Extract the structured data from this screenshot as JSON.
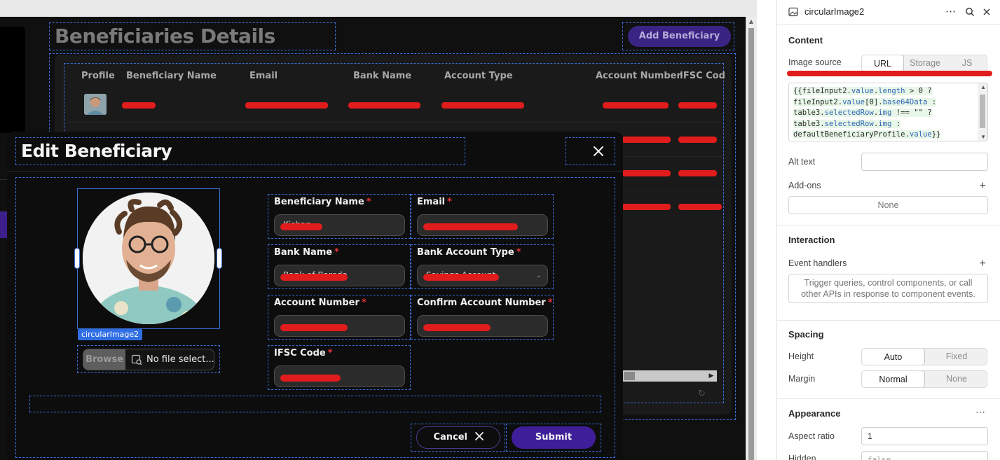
{
  "canvas": {
    "page_title": "Beneficiaries Details",
    "add_button": "Add Beneficiary",
    "table": {
      "columns": [
        "Profile",
        "Beneficiary Name",
        "Email",
        "Bank Name",
        "Account Type",
        "Account Number",
        "IFSC Cod"
      ]
    }
  },
  "modal": {
    "title": "Edit Beneficiary",
    "component_tag": "circularImage2",
    "file_input": {
      "browse_label": "Browse",
      "placeholder": "No file select..."
    },
    "fields": [
      {
        "label": "Beneficiary Name",
        "required": "*",
        "value": "Kishan"
      },
      {
        "label": "Email",
        "required": "*",
        "value": ""
      },
      {
        "label": "Bank Name",
        "required": "*",
        "value": "Bank of Baroda"
      },
      {
        "label": "Bank Account Type",
        "required": "*",
        "value": "Savings Account"
      },
      {
        "label": "Account Number",
        "required": "*",
        "value": ""
      },
      {
        "label": "Confirm Account Number",
        "required": "*",
        "value": ""
      },
      {
        "label": "IFSC Code",
        "required": "*",
        "value": ""
      }
    ],
    "cancel_label": "Cancel",
    "submit_label": "Submit"
  },
  "inspector": {
    "component_name": "circularImage2",
    "content_heading": "Content",
    "image_source_label": "Image source",
    "image_source_options": [
      "URL",
      "Storage",
      "JS"
    ],
    "image_source_selected": "URL",
    "alt_text_label": "Alt text",
    "alt_text_value": "",
    "addons_label": "Add-ons",
    "addons_value": "None",
    "interaction_heading": "Interaction",
    "event_handlers_label": "Event handlers",
    "event_handlers_hint": "Trigger queries, control components, or call other APIs in response to component events.",
    "spacing_heading": "Spacing",
    "height_label": "Height",
    "height_options": [
      "Auto",
      "Fixed"
    ],
    "height_selected": "Auto",
    "margin_label": "Margin",
    "margin_options": [
      "Normal",
      "None"
    ],
    "margin_selected": "Normal",
    "appearance_heading": "Appearance",
    "aspect_ratio_label": "Aspect ratio",
    "aspect_ratio_value": "1",
    "hidden_label": "Hidden",
    "hidden_value": "false"
  },
  "icons": [
    "image-icon",
    "more-icon",
    "search-icon",
    "close-icon",
    "plus-icon",
    "chevron-down-icon",
    "refresh-icon",
    "file-image-icon"
  ],
  "colors": {
    "accent": "#3a2483",
    "submit": "#3f1e9a",
    "required": "#e3343a",
    "selection": "#3b6fd6",
    "redaction": "#e01c1c"
  }
}
